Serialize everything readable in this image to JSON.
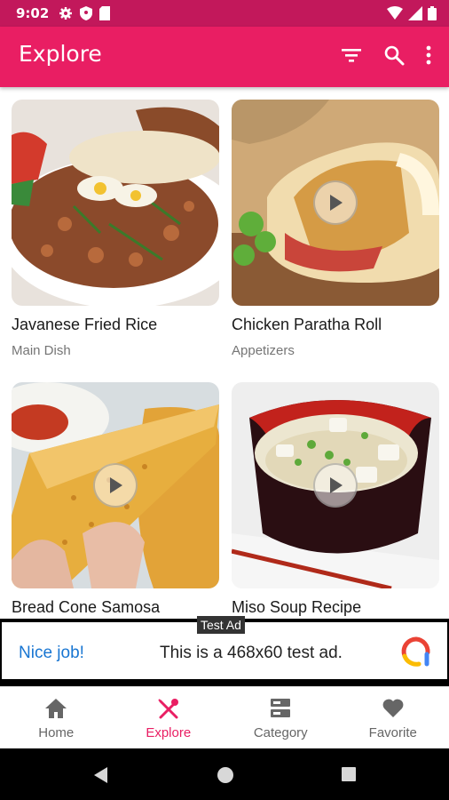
{
  "status_bar": {
    "time": "9:02"
  },
  "app_bar": {
    "title": "Explore",
    "actions": [
      {
        "icon": "filter-icon"
      },
      {
        "icon": "search-icon"
      },
      {
        "icon": "more-vert-icon"
      }
    ]
  },
  "recipes": [
    {
      "title": "Javanese Fried Rice",
      "category": "Main Dish",
      "has_video": false
    },
    {
      "title": "Chicken Paratha Roll",
      "category": "Appetizers",
      "has_video": true
    },
    {
      "title": "Bread Cone Samosa",
      "category": "",
      "has_video": true
    },
    {
      "title": "Miso Soup Recipe",
      "category": "",
      "has_video": true
    }
  ],
  "ad": {
    "label": "Test Ad",
    "cta": "Nice job!",
    "text": "This is a 468x60 test ad."
  },
  "bottom_nav": {
    "items": [
      {
        "label": "Home",
        "icon": "home-icon",
        "active": false
      },
      {
        "label": "Explore",
        "icon": "explore-utensils-icon",
        "active": true
      },
      {
        "label": "Category",
        "icon": "category-icon",
        "active": false
      },
      {
        "label": "Favorite",
        "icon": "heart-icon",
        "active": false
      }
    ]
  },
  "colors": {
    "status_bar": "#c2185b",
    "primary": "#e91e63",
    "link_blue": "#1976d2"
  }
}
